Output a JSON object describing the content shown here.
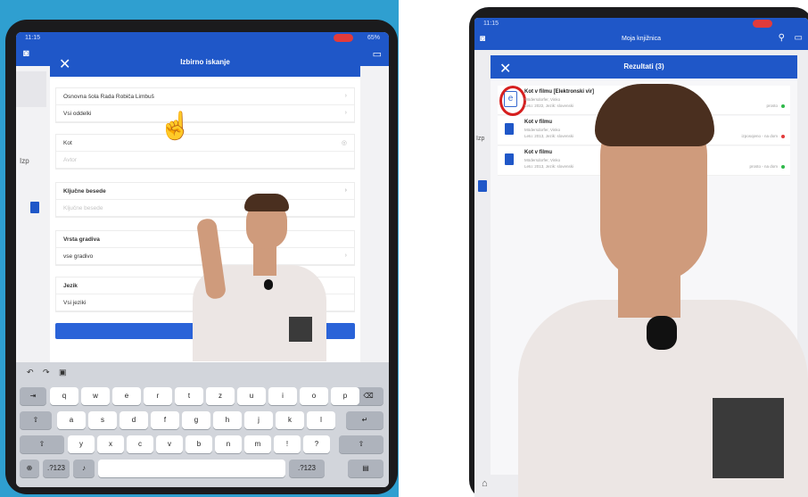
{
  "left": {
    "status": {
      "time": "11:15",
      "battery": "65%"
    },
    "modal": {
      "title": "Izbirno iskanje",
      "close": "✕",
      "school": "Osnovna šola Rada Robiča Limbuš",
      "departments": "Vsi oddelki",
      "title_value": "Kot",
      "author_placeholder": "Avtor",
      "keywords_label": "Ključne besede",
      "keywords_placeholder": "Ključne besede",
      "material_label": "Vrsta gradiva",
      "material_value": "vse gradivo",
      "language_label": "Jezik",
      "language_value": "Vsi jeziki"
    },
    "background": {
      "side_label": "Izp"
    },
    "keyboard": {
      "row1": [
        "q",
        "w",
        "e",
        "r",
        "t",
        "z",
        "u",
        "i",
        "o",
        "p"
      ],
      "row2": [
        "a",
        "s",
        "d",
        "f",
        "g",
        "h",
        "j",
        "k",
        "l"
      ],
      "row3": [
        "y",
        "x",
        "c",
        "v",
        "b",
        "n",
        "m",
        "!",
        "?"
      ],
      "numkey": ".?123"
    }
  },
  "right": {
    "app_title": "Moja knjižnica",
    "modal_title": "Rezultati (3)",
    "close": "✕",
    "side_label": "Izp",
    "results": [
      {
        "title": "Kot v filmu [Elektronski vir]",
        "author": "Mödersdorfer, Vinko",
        "meta": "Leto: 2022, Jezik: slovenski",
        "status": "prosto",
        "dot": "#2fb84a",
        "type": "ebook"
      },
      {
        "title": "Kot v filmu",
        "author": "Mödersdorfer, Vinko",
        "meta": "Leto: 2013, Jezik: slovenski",
        "status": "izposojeno - na dom",
        "dot": "#e23b3b",
        "type": "book"
      },
      {
        "title": "Kot v filmu",
        "author": "Mödersdorfer, Vinko",
        "meta": "Leto: 2013, Jezik: slovenski",
        "status": "prosto - na dom",
        "dot": "#2fb84a",
        "type": "book"
      }
    ]
  },
  "colors": {
    "brand_blue": "#1f57c8",
    "highlight_red": "#d61f1f"
  }
}
